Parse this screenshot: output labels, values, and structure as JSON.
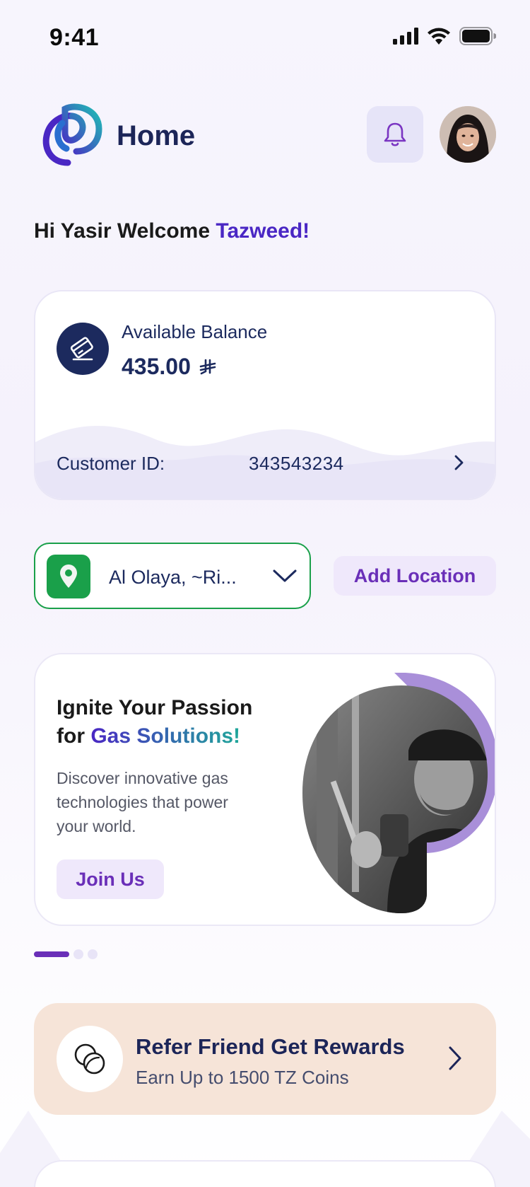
{
  "status_bar": {
    "time": "9:41"
  },
  "header": {
    "title": "Home"
  },
  "greeting": {
    "prefix": "Hi Yasir Welcome ",
    "highlight": "Tazweed!"
  },
  "balance": {
    "label": "Available Balance",
    "amount": "435.00",
    "currency_symbol": "⃁",
    "customer_id_label": "Customer ID:",
    "customer_id": "343543234"
  },
  "location": {
    "selected": "Al Olaya, ~Ri...",
    "add_label": "Add Location"
  },
  "promo": {
    "title_line1": "Ignite Your Passion",
    "title_prefix": "for ",
    "title_highlight": "Gas Solutions!",
    "description": "Discover innovative gas technologies that power your world.",
    "button_label": "Join Us"
  },
  "carousel": {
    "count": 3,
    "active_index": 0
  },
  "refer": {
    "title": "Refer Friend Get Rewards",
    "subtitle": "Earn Up to 1500 TZ Coins"
  },
  "colors": {
    "primary": "#4a27c4",
    "accent_purple": "#6a2fb8",
    "navy": "#1c2a5e",
    "green": "#1aa04a",
    "refer_bg": "#f6e4d8"
  },
  "icons": {
    "signal": "cellular-signal-icon",
    "wifi": "wifi-icon",
    "battery": "battery-icon",
    "bell": "bell-icon",
    "wallet": "card-icon",
    "pin": "location-pin-icon",
    "coins": "coins-icon"
  }
}
